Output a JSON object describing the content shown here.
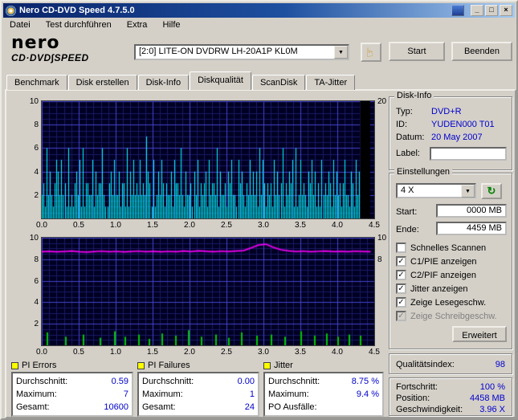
{
  "window": {
    "title": "Nero CD-DVD Speed 4.7.5.0",
    "menu": [
      "Datei",
      "Test durchführen",
      "Extra",
      "Hilfe"
    ]
  },
  "icons": {
    "minimize": "_",
    "maximize": "□",
    "close": "×",
    "dropdown": "▼",
    "refresh": "↻",
    "hand": "☞",
    "check": "✓"
  },
  "colors": {
    "value_text": "#0000CC",
    "legend_square": "#FFFF00",
    "titlebar_left": "#0A246A",
    "titlebar_right": "#A6CAF0"
  },
  "header": {
    "logo_line1": "nero",
    "logo_line2": "CD·DVD∫SPEED",
    "drive": "[2:0]  LITE-ON DVDRW LH-20A1P KL0M",
    "start_label": "Start",
    "quit_label": "Beenden"
  },
  "tabs": [
    {
      "label": "Benchmark",
      "active": false
    },
    {
      "label": "Disk erstellen",
      "active": false
    },
    {
      "label": "Disk-Info",
      "active": false
    },
    {
      "label": "Diskqualität",
      "active": true
    },
    {
      "label": "ScanDisk",
      "active": false
    },
    {
      "label": "TA-Jitter",
      "active": false
    }
  ],
  "disk_info": {
    "title": "Disk-Info",
    "rows": [
      {
        "label": "Typ:",
        "value": "DVD+R"
      },
      {
        "label": "ID:",
        "value": "YUDEN000 T01"
      },
      {
        "label": "Datum:",
        "value": "20 May 2007"
      },
      {
        "label": "Label:",
        "value": ""
      }
    ]
  },
  "settings": {
    "title": "Einstellungen",
    "speed": "4 X",
    "start_label": "Start:",
    "start_value": "0000 MB",
    "end_label": "Ende:",
    "end_value": "4459 MB",
    "checkboxes": [
      {
        "label": "Schnelles Scannen",
        "checked": false,
        "disabled": false
      },
      {
        "label": "C1/PIE anzeigen",
        "checked": true,
        "disabled": false
      },
      {
        "label": "C2/PIF anzeigen",
        "checked": true,
        "disabled": false
      },
      {
        "label": "Jitter anzeigen",
        "checked": true,
        "disabled": false
      },
      {
        "label": "Zeige Lesegeschw.",
        "checked": true,
        "disabled": false
      },
      {
        "label": "Zeige Schreibgeschw.",
        "checked": true,
        "disabled": true
      }
    ],
    "advanced_label": "Erweitert"
  },
  "quality": {
    "label": "Qualitätsindex:",
    "value": "98"
  },
  "progress": {
    "rows": [
      {
        "label": "Fortschritt:",
        "value": "100 %"
      },
      {
        "label": "Position:",
        "value": "4458 MB"
      },
      {
        "label": "Geschwindigkeit:",
        "value": "3.96 X"
      }
    ]
  },
  "stats": [
    {
      "title": "PI Errors",
      "color": "#FFFF00",
      "rows": [
        {
          "label": "Durchschnitt:",
          "value": "0.59"
        },
        {
          "label": "Maximum:",
          "value": "7"
        },
        {
          "label": "Gesamt:",
          "value": "10600"
        }
      ]
    },
    {
      "title": "PI Failures",
      "color": "#FFFF00",
      "rows": [
        {
          "label": "Durchschnitt:",
          "value": "0.00"
        },
        {
          "label": "Maximum:",
          "value": "1"
        },
        {
          "label": "Gesamt:",
          "value": "24"
        }
      ]
    },
    {
      "title": "Jitter",
      "color": "#FFFF00",
      "rows": [
        {
          "label": "Durchschnitt:",
          "value": "8.75 %"
        },
        {
          "label": "Maximum:",
          "value": "9.4 %"
        },
        {
          "label": "PO Ausfälle:",
          "value": ""
        }
      ]
    }
  ],
  "chart_data": [
    {
      "type": "bar",
      "name": "pi-errors-scan",
      "title": "PI Errors vs position (GB)",
      "xlim": [
        0,
        4.5
      ],
      "ylim": [
        0,
        10
      ],
      "grid": true,
      "x_ticks": [
        "0.0",
        "0.5",
        "1.0",
        "1.5",
        "2.0",
        "2.5",
        "3.0",
        "3.5",
        "4.0",
        "4.5"
      ],
      "y_ticks_left": [
        {
          "v": 10,
          "label": "10"
        },
        {
          "v": 8,
          "label": "8"
        },
        {
          "v": 6,
          "label": "6"
        },
        {
          "v": 4,
          "label": "4"
        },
        {
          "v": 2,
          "label": "2"
        }
      ],
      "y_ticks_right": [
        {
          "v": 10,
          "label": "20"
        }
      ],
      "bar_color": "#00FFFF",
      "bg_color": "#000022",
      "data_end_gb": 4.43,
      "gap_x": [
        4.31,
        4.445
      ],
      "bars_digits": [
        "2316242135",
        "4252316121",
        "3425161332",
        "2514233621",
        "1342522413",
        "3161425232",
        "5232743151",
        "2425313224",
        "1533262142",
        "2314251323",
        "4152332614",
        "2231435221",
        "5342132524",
        "2416253132",
        "3152423613",
        "2435161252",
        "3214352413",
        "1523243152",
        "4231352214",
        "3152400000"
      ]
    },
    {
      "type": "line+bar",
      "name": "jitter-and-pi-failures",
      "title": "Jitter (%) and PI Failures vs position (GB)",
      "xlim": [
        0,
        4.5
      ],
      "ylim": [
        0,
        10
      ],
      "grid": true,
      "x_ticks": [
        "0.0",
        "0.5",
        "1.0",
        "1.5",
        "2.0",
        "2.5",
        "3.0",
        "3.5",
        "4.0",
        "4.5"
      ],
      "y_ticks_left": [
        {
          "v": 10,
          "label": "10"
        },
        {
          "v": 8,
          "label": "8"
        },
        {
          "v": 6,
          "label": "6"
        },
        {
          "v": 4,
          "label": "4"
        },
        {
          "v": 2,
          "label": "2"
        }
      ],
      "y_ticks_right": [
        {
          "v": 10,
          "label": "10"
        },
        {
          "v": 8,
          "label": "8"
        }
      ],
      "line_color": "#FF00FF",
      "bar_color": "#00C800",
      "bg_color": "#000022",
      "jitter_points": [
        8.7,
        8.74,
        8.69,
        8.72,
        8.76,
        8.7,
        8.66,
        8.71,
        8.75,
        8.7,
        8.73,
        8.68,
        8.72,
        8.75,
        8.7,
        8.74,
        8.69,
        8.73,
        8.7,
        8.76,
        8.72,
        8.78,
        8.74,
        8.7,
        8.75,
        8.72,
        8.76,
        8.8,
        9.05,
        9.32,
        9.4,
        9.1,
        8.88,
        8.78,
        8.72,
        8.75,
        8.7,
        8.73,
        8.76,
        8.71,
        8.74,
        8.7,
        8.75,
        8.72,
        8.7
      ],
      "pif_bars": [
        {
          "x": 0.07,
          "h": 1.2
        },
        {
          "x": 0.32,
          "h": 0.8
        },
        {
          "x": 0.55,
          "h": 1.0
        },
        {
          "x": 0.78,
          "h": 0.7
        },
        {
          "x": 0.98,
          "h": 1.3
        },
        {
          "x": 1.12,
          "h": 0.8
        },
        {
          "x": 1.3,
          "h": 1.0
        },
        {
          "x": 1.45,
          "h": 0.6
        },
        {
          "x": 1.62,
          "h": 1.1
        },
        {
          "x": 1.8,
          "h": 0.9
        },
        {
          "x": 1.98,
          "h": 1.4
        },
        {
          "x": 2.15,
          "h": 0.8
        },
        {
          "x": 2.35,
          "h": 1.0
        },
        {
          "x": 2.52,
          "h": 0.7
        },
        {
          "x": 2.7,
          "h": 1.2
        },
        {
          "x": 2.9,
          "h": 0.9
        },
        {
          "x": 3.1,
          "h": 1.0
        },
        {
          "x": 3.28,
          "h": 0.8
        },
        {
          "x": 3.5,
          "h": 1.3
        },
        {
          "x": 3.68,
          "h": 0.9
        },
        {
          "x": 3.85,
          "h": 1.1
        },
        {
          "x": 4.0,
          "h": 0.8
        },
        {
          "x": 4.15,
          "h": 1.0
        },
        {
          "x": 4.3,
          "h": 0.9
        }
      ]
    }
  ]
}
